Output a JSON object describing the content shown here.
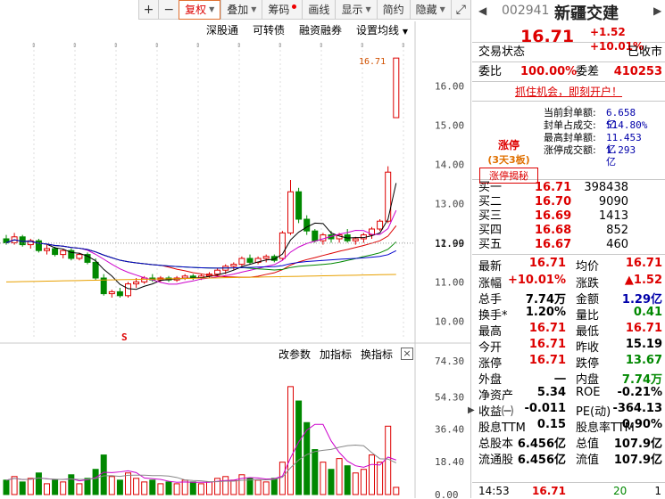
{
  "toolbar": [
    "+",
    "−",
    "复权",
    "叠加",
    "筹码",
    "画线",
    "显示",
    "简约",
    "隐藏"
  ],
  "subbar": [
    "深股通",
    "可转债",
    "融资融券",
    "设置均线"
  ],
  "price_axis": [
    "16.00",
    "15.00",
    "14.00",
    "13.00",
    "12.00",
    "11.99",
    "11.00",
    "10.00"
  ],
  "last_marker": "16.71",
  "vol_axis": [
    "74.30",
    "54.30",
    "36.40",
    "18.40",
    "0.00"
  ],
  "vol_buttons": [
    "改参数",
    "加指标",
    "换指标"
  ],
  "marker_s": "S",
  "stock": {
    "code": "002941",
    "name": "新疆交建",
    "price": "16.71",
    "change": "+1.52",
    "pct": "+10.01%",
    "status_label": "交易状态",
    "status_value": "已收市",
    "weibi_label": "委比",
    "weibi_value": "100.00%",
    "weicha_label": "委差",
    "weicha_value": "410253"
  },
  "ad_text": "抓住机会，即刻开户！",
  "limit": {
    "tag": "涨停",
    "sub": "(3天3板)",
    "button": "涨停揭秘",
    "rows": [
      {
        "label": "当前封单额:",
        "value": "6.658亿"
      },
      {
        "label": "封单占成交:",
        "value": "514.80%"
      },
      {
        "label": "最高封单额:",
        "value": "11.453亿"
      },
      {
        "label": "涨停成交额:",
        "value": "1.293亿"
      }
    ]
  },
  "orderbook": [
    {
      "label": "买一",
      "price": "16.71",
      "vol": "398438"
    },
    {
      "label": "买二",
      "price": "16.70",
      "vol": "9090"
    },
    {
      "label": "买三",
      "price": "16.69",
      "vol": "1413"
    },
    {
      "label": "买四",
      "price": "16.68",
      "vol": "852"
    },
    {
      "label": "买五",
      "price": "16.67",
      "vol": "460"
    }
  ],
  "stats": [
    [
      "最新",
      "16.71",
      "均价",
      "16.71"
    ],
    [
      "涨幅",
      "+10.01%",
      "涨跌",
      "▲1.52"
    ],
    [
      "总手",
      "7.74万",
      "金额",
      "1.29亿"
    ],
    [
      "换手*",
      "1.20%",
      "量比",
      "0.41"
    ],
    [
      "最高",
      "16.71",
      "最低",
      "16.71"
    ],
    [
      "今开",
      "16.71",
      "昨收",
      "15.19"
    ],
    [
      "涨停",
      "16.71",
      "跌停",
      "13.67"
    ],
    [
      "外盘",
      "一",
      "内盘",
      "7.74万"
    ],
    [
      "净资产",
      "5.34",
      "ROE",
      "-0.21%"
    ],
    [
      "收益㈠",
      "-0.011",
      "PE(动)",
      "-364.13"
    ],
    [
      "股息TTM",
      "0.15",
      "股息率TTM",
      "0.90%"
    ],
    [
      "总股本",
      "6.456亿",
      "总值",
      "107.9亿"
    ],
    [
      "流通股",
      "6.456亿",
      "流值",
      "107.9亿"
    ]
  ],
  "footer": {
    "time": "14:53",
    "price": "16.71",
    "vol": "20",
    "count": "1"
  },
  "colors": {
    "up": "#dd0000",
    "down": "#008800",
    "ma5": "#000000",
    "ma10": "#cc00cc",
    "ma20": "#dd0000",
    "ma30": "#008800",
    "ma60": "#0000cc",
    "ma120": "#e8a000"
  },
  "chart_data": {
    "type": "candlestick",
    "ylim": [
      9.6,
      16.6
    ],
    "candles": [
      [
        12.1,
        12.2,
        11.95,
        12.0
      ],
      [
        12.0,
        12.25,
        11.95,
        12.15
      ],
      [
        12.15,
        12.2,
        11.9,
        11.95
      ],
      [
        11.95,
        12.1,
        11.85,
        12.05
      ],
      [
        12.05,
        12.1,
        11.75,
        11.8
      ],
      [
        11.8,
        11.95,
        11.7,
        11.85
      ],
      [
        11.85,
        11.9,
        11.65,
        11.7
      ],
      [
        11.7,
        11.85,
        11.6,
        11.8
      ],
      [
        11.8,
        11.85,
        11.55,
        11.6
      ],
      [
        11.6,
        11.75,
        11.55,
        11.7
      ],
      [
        11.7,
        11.75,
        11.45,
        11.5
      ],
      [
        11.5,
        11.6,
        11.05,
        11.1
      ],
      [
        11.1,
        11.2,
        10.65,
        10.7
      ],
      [
        10.7,
        10.8,
        10.6,
        10.75
      ],
      [
        10.75,
        10.85,
        10.6,
        10.65
      ],
      [
        10.65,
        11.0,
        10.6,
        10.95
      ],
      [
        10.95,
        11.1,
        10.85,
        11.0
      ],
      [
        11.0,
        11.15,
        10.95,
        11.1
      ],
      [
        11.1,
        11.2,
        11.0,
        11.05
      ],
      [
        11.05,
        11.15,
        11.0,
        11.1
      ],
      [
        11.1,
        11.15,
        11.0,
        11.05
      ],
      [
        11.05,
        11.15,
        11.0,
        11.1
      ],
      [
        11.1,
        11.2,
        11.05,
        11.15
      ],
      [
        11.15,
        11.2,
        11.05,
        11.1
      ],
      [
        11.1,
        11.2,
        11.05,
        11.15
      ],
      [
        11.15,
        11.25,
        11.1,
        11.2
      ],
      [
        11.2,
        11.35,
        11.15,
        11.3
      ],
      [
        11.3,
        11.45,
        11.2,
        11.4
      ],
      [
        11.4,
        11.5,
        11.3,
        11.45
      ],
      [
        11.45,
        11.65,
        11.4,
        11.6
      ],
      [
        11.6,
        11.7,
        11.45,
        11.5
      ],
      [
        11.5,
        11.65,
        11.45,
        11.6
      ],
      [
        11.6,
        11.7,
        11.5,
        11.65
      ],
      [
        11.65,
        11.7,
        11.5,
        11.55
      ],
      [
        11.6,
        12.3,
        11.55,
        12.25
      ],
      [
        12.25,
        13.6,
        12.2,
        13.3
      ],
      [
        13.3,
        13.4,
        12.5,
        12.6
      ],
      [
        12.6,
        12.7,
        12.2,
        12.3
      ],
      [
        12.3,
        12.35,
        12.0,
        12.05
      ],
      [
        12.05,
        12.25,
        11.95,
        12.2
      ],
      [
        12.2,
        12.3,
        12.0,
        12.1
      ],
      [
        12.1,
        12.25,
        12.0,
        12.2
      ],
      [
        12.2,
        12.35,
        12.0,
        12.05
      ],
      [
        12.05,
        12.15,
        11.95,
        12.1
      ],
      [
        12.1,
        12.25,
        12.0,
        12.2
      ],
      [
        12.2,
        12.4,
        12.1,
        12.35
      ],
      [
        12.35,
        12.6,
        12.3,
        12.55
      ],
      [
        12.55,
        13.95,
        12.5,
        13.8
      ],
      [
        15.19,
        16.71,
        15.19,
        16.71
      ]
    ],
    "volume": [
      8,
      10,
      7,
      9,
      12,
      6,
      8,
      7,
      11,
      6,
      9,
      14,
      22,
      10,
      8,
      12,
      9,
      7,
      8,
      6,
      7,
      6,
      8,
      7,
      6,
      7,
      9,
      10,
      8,
      11,
      9,
      8,
      7,
      9,
      18,
      60,
      52,
      40,
      25,
      18,
      14,
      20,
      16,
      12,
      14,
      22,
      18,
      38,
      4
    ]
  }
}
